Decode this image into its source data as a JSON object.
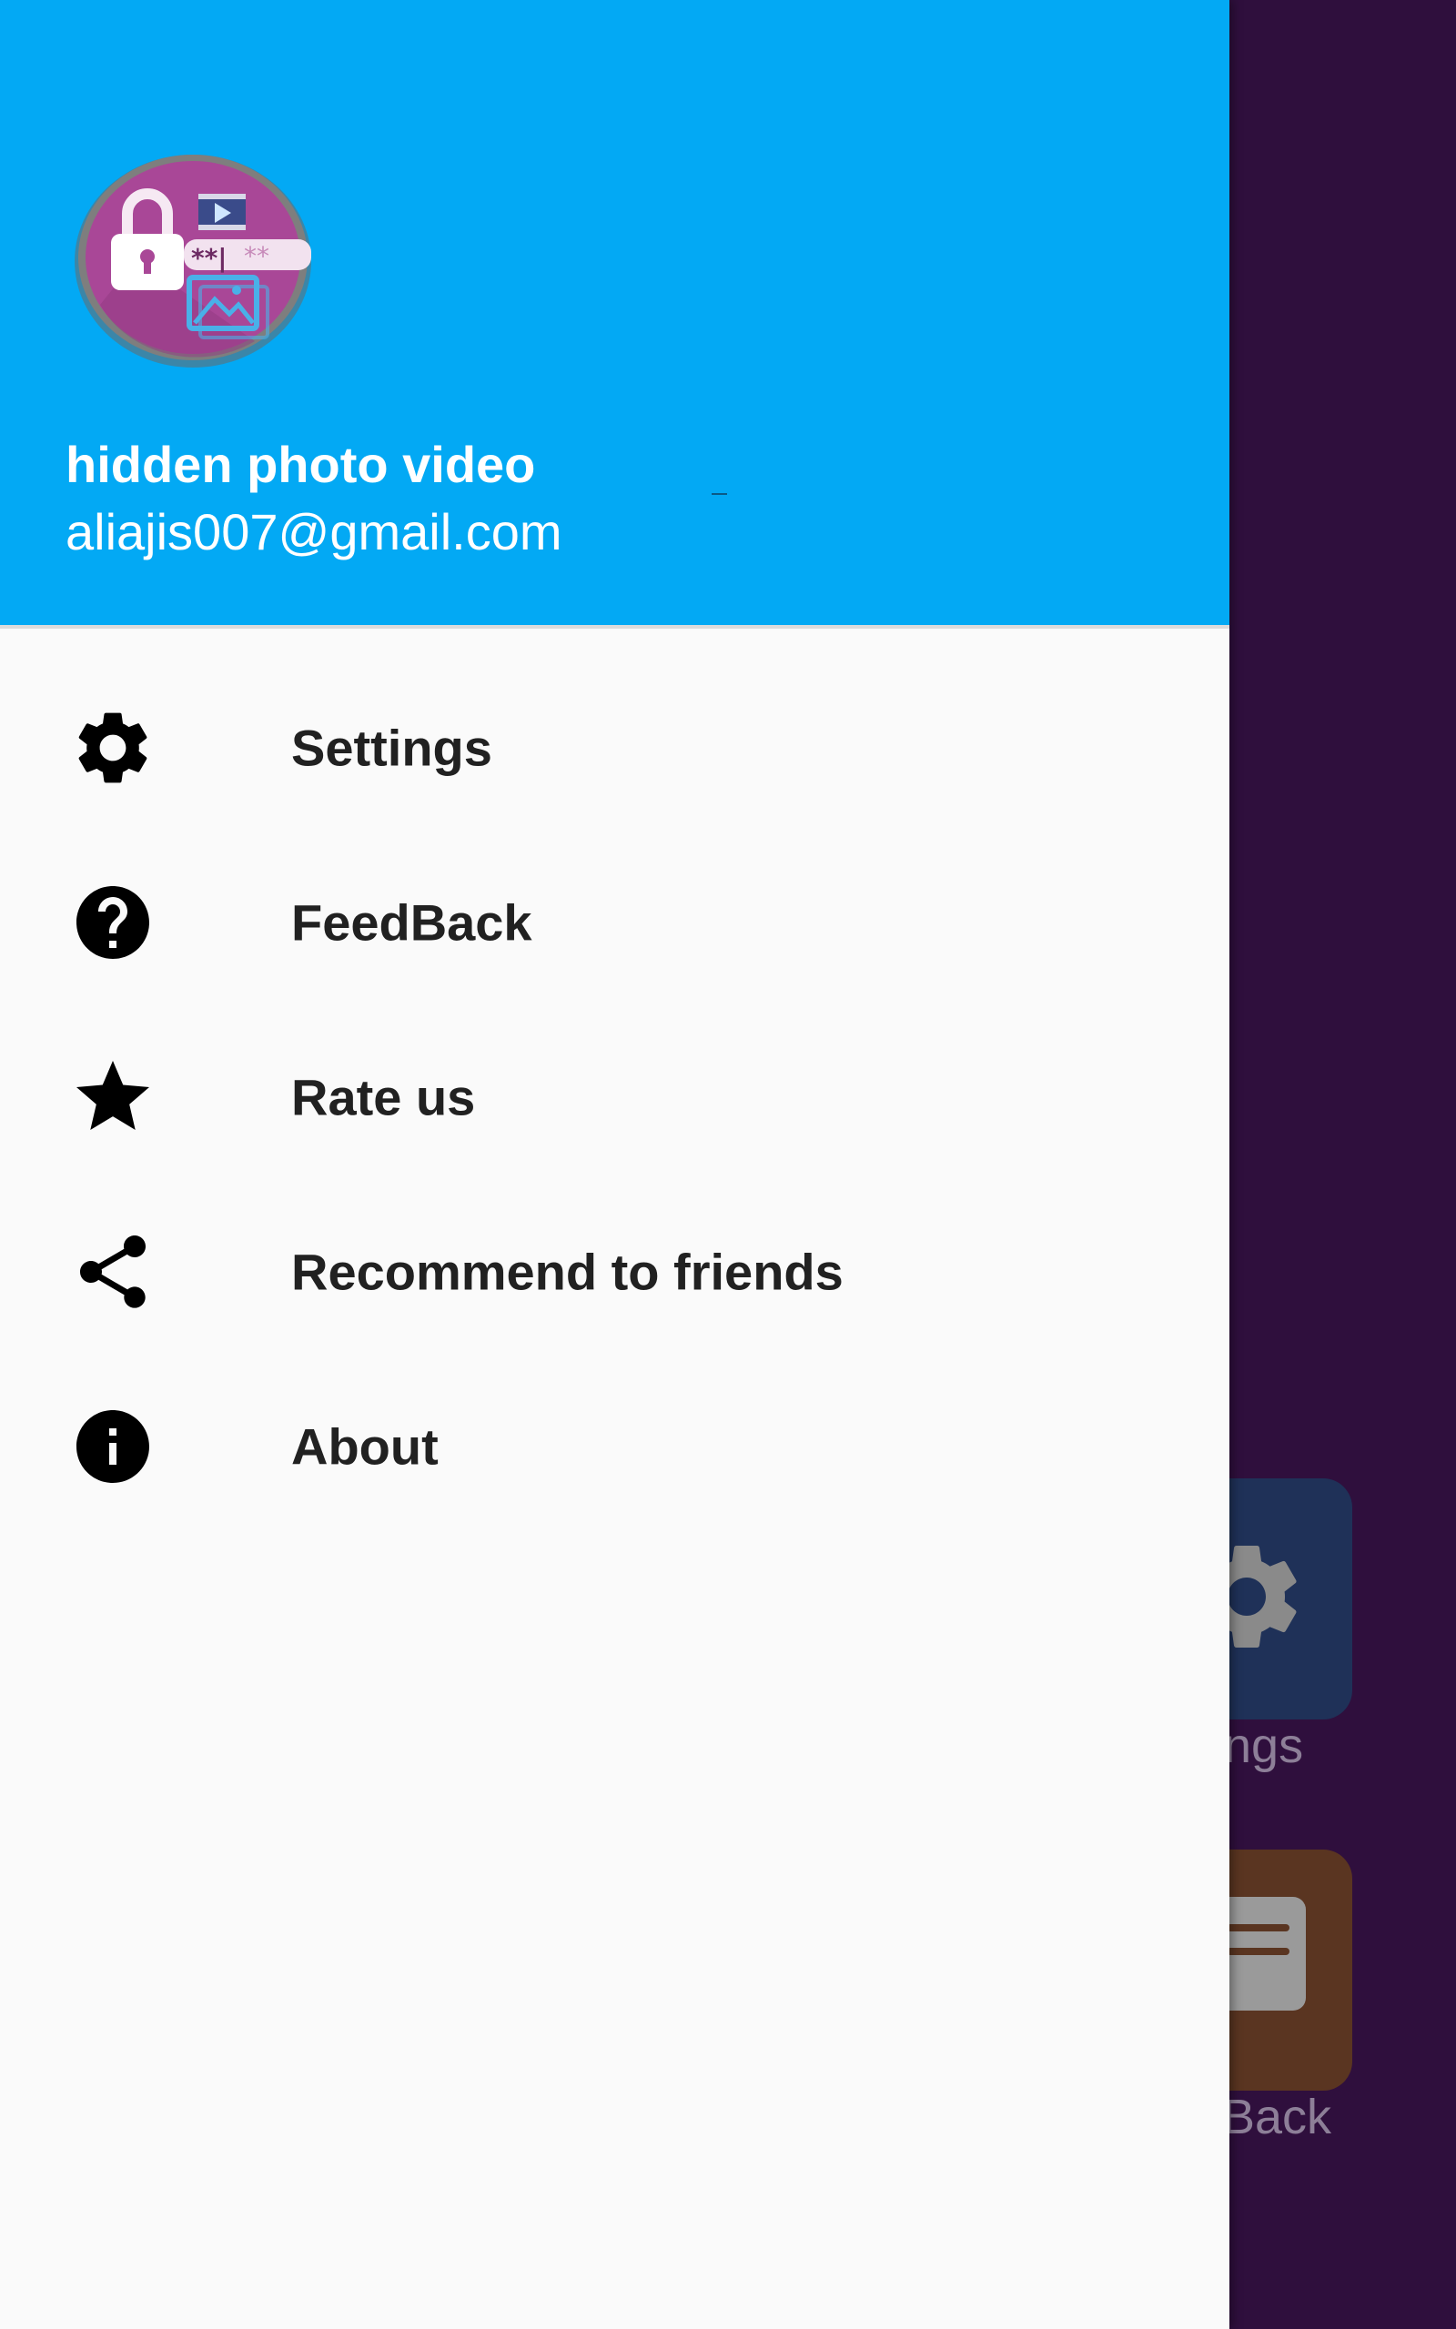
{
  "header": {
    "app_name": "hidden photo video",
    "email": "aliajis007@gmail.com"
  },
  "menu": [
    {
      "label": "Settings",
      "icon": "gear-icon"
    },
    {
      "label": "FeedBack",
      "icon": "help-circle-icon"
    },
    {
      "label": "Rate us",
      "icon": "star-icon"
    },
    {
      "label": "Recommend to friends",
      "icon": "share-icon"
    },
    {
      "label": "About",
      "icon": "info-icon"
    }
  ],
  "background": {
    "settings_label_partial": "ngs",
    "feedback_label_partial": "Back"
  },
  "colors": {
    "header_bg": "#03a9f4",
    "drawer_bg": "#fafafa",
    "scrim_bg": "#2f0f3d",
    "logo_purple": "#a94797"
  }
}
